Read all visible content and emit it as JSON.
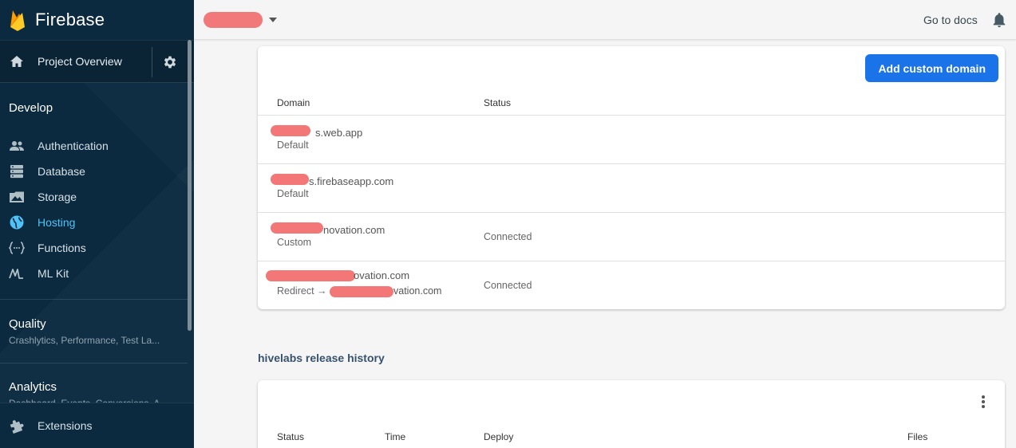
{
  "brand": {
    "name": "Firebase"
  },
  "sidebar": {
    "overview_label": "Project Overview",
    "develop_title": "Develop",
    "items": [
      {
        "label": "Authentication",
        "icon": "people-icon",
        "active": false
      },
      {
        "label": "Database",
        "icon": "database-icon",
        "active": false
      },
      {
        "label": "Storage",
        "icon": "image-icon",
        "active": false
      },
      {
        "label": "Hosting",
        "icon": "globe-icon",
        "active": true
      },
      {
        "label": "Functions",
        "icon": "functions-icon",
        "active": false
      },
      {
        "label": "ML Kit",
        "icon": "mlkit-icon",
        "active": false
      }
    ],
    "quality": {
      "title": "Quality",
      "subtitle": "Crashlytics, Performance, Test La..."
    },
    "analytics": {
      "title": "Analytics",
      "subtitle": "Dashboard, Events, Conversions, A..."
    },
    "extensions_label": "Extensions",
    "accent_color": "#4fc3f7"
  },
  "topbar": {
    "docs_label": "Go to docs"
  },
  "domains": {
    "add_button_label": "Add custom domain",
    "headers": {
      "domain": "Domain",
      "status": "Status"
    },
    "rows": [
      {
        "name": "s.web.app",
        "type": "Default",
        "status": ""
      },
      {
        "name": "s.firebaseapp.com",
        "type": "Default",
        "status": ""
      },
      {
        "name": "novation.com",
        "type": "Custom",
        "status": "Connected"
      },
      {
        "name": "ovation.com",
        "type": "Redirect →",
        "target": "vation.com",
        "status": "Connected"
      }
    ]
  },
  "history": {
    "title": "hivelabs release history",
    "headers": {
      "status": "Status",
      "time": "Time",
      "deploy": "Deploy",
      "files": "Files"
    }
  },
  "colors": {
    "primary_button": "#1a73e8",
    "sidebar_bg": "#0b2a3f",
    "redaction": "#f26b6b"
  }
}
